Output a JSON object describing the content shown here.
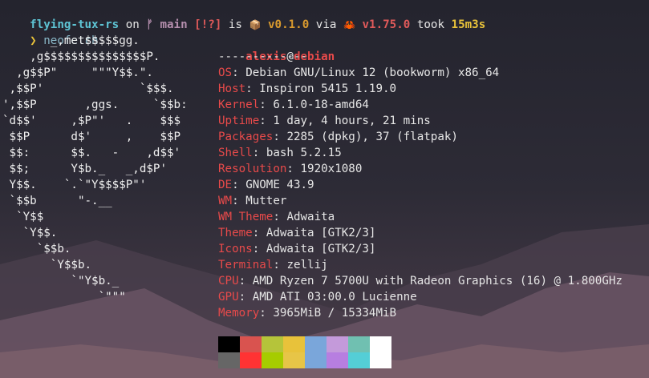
{
  "prompt": {
    "repo": "flying-tux-rs",
    "on": " on ",
    "branch_icon": "ᚠ",
    "branch": "main",
    "status": "[!?]",
    "is": " is ",
    "pkg_icon": "📦",
    "version": "v0.1.0",
    "via": " via ",
    "rust_icon": "🦀",
    "rust_version": "v1.75.0",
    "took": " took ",
    "duration": "15m3s",
    "symbol": "❯",
    "command": "neofetch"
  },
  "logo_lines": [
    "       _,met$$$$$gg.",
    "    ,g$$$$$$$$$$$$$$$P.",
    "  ,g$$P\"     \"\"\"Y$$.\".",
    " ,$$P'              `$$$.",
    "',$$P       ,ggs.     `$$b:",
    "`d$$'     ,$P\"'   .    $$$",
    " $$P      d$'     ,    $$P",
    " $$:      $$.   -    ,d$$'",
    " $$;      Y$b._   _,d$P'",
    " Y$$.    `.`\"Y$$$$P\"'",
    " `$$b      \"-.__",
    "  `Y$$",
    "   `Y$$.",
    "     `$$b.",
    "       `Y$$b.",
    "          `\"Y$b._",
    "              `\"\"\""
  ],
  "info": {
    "user": "alexis",
    "at": "@",
    "host": "debian",
    "separator": "-------------",
    "rows": [
      {
        "key": "OS",
        "value": "Debian GNU/Linux 12 (bookworm) x86_64"
      },
      {
        "key": "Host",
        "value": "Inspiron 5415 1.19.0"
      },
      {
        "key": "Kernel",
        "value": "6.1.0-18-amd64"
      },
      {
        "key": "Uptime",
        "value": "1 day, 4 hours, 21 mins"
      },
      {
        "key": "Packages",
        "value": "2285 (dpkg), 37 (flatpak)"
      },
      {
        "key": "Shell",
        "value": "bash 5.2.15"
      },
      {
        "key": "Resolution",
        "value": "1920x1080"
      },
      {
        "key": "DE",
        "value": "GNOME 43.9"
      },
      {
        "key": "WM",
        "value": "Mutter"
      },
      {
        "key": "WM Theme",
        "value": "Adwaita"
      },
      {
        "key": "Theme",
        "value": "Adwaita [GTK2/3]"
      },
      {
        "key": "Icons",
        "value": "Adwaita [GTK2/3]"
      },
      {
        "key": "Terminal",
        "value": "zellij"
      },
      {
        "key": "CPU",
        "value": "AMD Ryzen 7 5700U with Radeon Graphics (16) @ 1.800GHz"
      },
      {
        "key": "GPU",
        "value": "AMD ATI 03:00.0 Lucienne"
      },
      {
        "key": "Memory",
        "value": "3965MiB / 15334MiB"
      }
    ]
  },
  "palette": {
    "top": [
      "#000000",
      "#d9534f",
      "#b5c43a",
      "#e8c23a",
      "#7aa6da",
      "#c49ada",
      "#70c0b1",
      "#ffffff"
    ],
    "bottom": [
      "#666666",
      "#ff3333",
      "#a6cc00",
      "#e7c547",
      "#7aa6da",
      "#b77ee0",
      "#54ced6",
      "#ffffff"
    ]
  },
  "colors": {
    "background_top": "#2b2b36",
    "mountain_far": "#6e5a6c",
    "mountain_near": "#8a6a78",
    "accent_red": "#e84a4a"
  }
}
